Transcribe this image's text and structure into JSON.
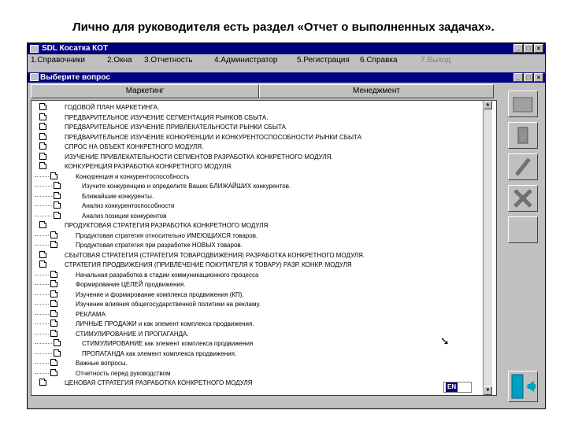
{
  "slide": {
    "title": "Лично для руководителя есть раздел «Отчет о выполненных задачах»."
  },
  "app": {
    "title": "SDL Косатка КОТ"
  },
  "menu": [
    {
      "label": "1.Справочники",
      "disabled": false
    },
    {
      "label": "2.Окна",
      "disabled": false
    },
    {
      "label": "3.Отчетность",
      "disabled": false
    },
    {
      "label": "4.Администратор",
      "disabled": false
    },
    {
      "label": "5.Регистрация",
      "disabled": false
    },
    {
      "label": "6.Справка",
      "disabled": false
    },
    {
      "label": "7.Выход",
      "disabled": true
    }
  ],
  "dialog": {
    "title": "Выберите вопрос"
  },
  "tabs": [
    "Маркетинг",
    "Менеджмент"
  ],
  "tree": [
    {
      "level": 0,
      "text": "ГОДОВОЙ ПЛАН МАРКЕТИНГА."
    },
    {
      "level": 0,
      "text": "ПРЕДВАРИТЕЛЬНОЕ ИЗУЧЕНИЕ СЕГМЕНТАЦИЯ РЫНКОВ СБЫТА."
    },
    {
      "level": 0,
      "text": "ПРЕДВАРИТЕЛЬНОЕ ИЗУЧЕНИЕ ПРИВЛЕКАТЕЛЬНОСТИ РЫНКИ СБЫТА"
    },
    {
      "level": 0,
      "text": "ПРЕДВАРИТЕЛЬНОЕ ИЗУЧЕНИЕ КОНКУРЕНЦИИ И КОНКУРЕНТОСПОСОБНОСТИ РЫНКИ СБЫТА"
    },
    {
      "level": 0,
      "text": "СПРОС НА ОБЪЕКТ КОНКРЕТНОГО МОДУЛЯ."
    },
    {
      "level": 0,
      "text": "ИЗУЧЕНИЕ ПРИВЛЕКАТЕЛЬНОСТИ СЕГМЕНТОВ РАЗРАБОТКА КОНКРЕТНОГО МОДУЛЯ."
    },
    {
      "level": 0,
      "text": "КОНКУРЕНЦИЯ РАЗРАБОТКА КОНКРЕТНОГО МОДУЛЯ."
    },
    {
      "level": 1,
      "text": "Конкуренция и конкурентоспособность"
    },
    {
      "level": 2,
      "text": "Изучите конкуренцию и определите Ваших БЛИЖАЙШИХ конкурентов."
    },
    {
      "level": 2,
      "text": "Ближайшие конкуренты."
    },
    {
      "level": 2,
      "text": "Анализ конкурентоспособности"
    },
    {
      "level": 2,
      "text": "Анализ позиции конкурентов"
    },
    {
      "level": 0,
      "text": "ПРОДУКТОВАЯ СТРАТЕГИЯ РАЗРАБОТКА КОНКРЕТНОГО МОДУЛЯ"
    },
    {
      "level": 1,
      "text": "Продуктовая стратегия относительно ИМЕЮЩИХСЯ товаров."
    },
    {
      "level": 1,
      "text": "Продуктовая стратегия при разработке НОВЫХ товаров."
    },
    {
      "level": 0,
      "text": "СБЫТОВАЯ СТРАТЕГИЯ (СТРАТЕГИЯ ТОВАРОДВИЖЕНИЯ) РАЗРАБОТКА КОНКРЕТНОГО МОДУЛЯ."
    },
    {
      "level": 0,
      "text": "СТРАТЕГИЯ ПРОДВИЖЕНИЯ (ПРИВЛЕЧЕНИЕ ПОКУПАТЕЛЯ К ТОВАРУ) РАЗР. КОНКР. МОДУЛЯ"
    },
    {
      "level": 1,
      "text": "Начальная разработка в стадии коммуникационного процесса"
    },
    {
      "level": 1,
      "text": "Формирование ЦЕЛЕЙ продвижения."
    },
    {
      "level": 1,
      "text": "Изучение и формирование комплекса продвижения (КП)."
    },
    {
      "level": 1,
      "text": "Изучение влияния общегосударственной политики на рекламу."
    },
    {
      "level": 1,
      "text": "РЕКЛАМА"
    },
    {
      "level": 1,
      "text": "ЛИЧНЫЕ ПРОДАЖИ и как элемент комплекса продвижения."
    },
    {
      "level": 1,
      "text": "СТИМУЛИРОВАНИЕ  И  ПРОПАГАНДА."
    },
    {
      "level": 2,
      "text": "СТИМУЛИРОВАНИЕ как элемент комплекса продвижения"
    },
    {
      "level": 2,
      "text": "ПРОПАГАНДА как элемент комплекса продвижения."
    },
    {
      "level": 1,
      "text": "Важные вопросы."
    },
    {
      "level": 1,
      "text": "Отчетность перед руководством"
    },
    {
      "level": 0,
      "text": "ЦЕНОВАЯ СТРАТЕГИЯ РАЗРАБОТКА КОНКРЕТНОГО МОДУЛЯ"
    }
  ],
  "lang": {
    "code": "EN"
  },
  "icons": [
    "window-minimize-icon",
    "window-maximize-icon",
    "window-close-icon",
    "folder-icon",
    "pencil-icon",
    "delete-icon",
    "exit-door-icon"
  ]
}
